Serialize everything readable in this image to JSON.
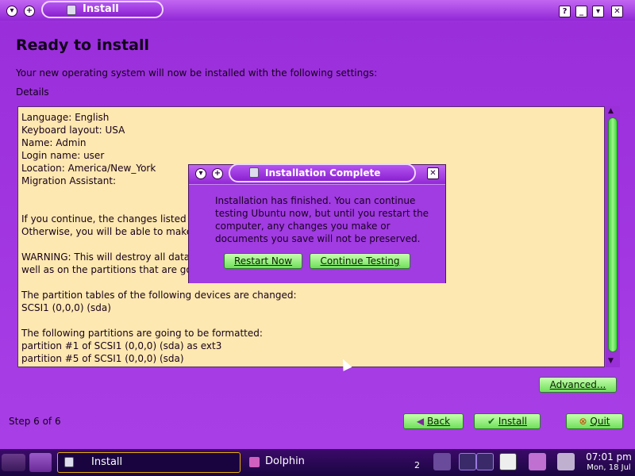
{
  "window": {
    "title": "Install",
    "heading": "Ready to install",
    "intro": "Your new operating system will now be installed with the following settings:",
    "details_label": "Details",
    "details_lines": [
      "Language: English",
      "Keyboard layout: USA",
      "Name: Admin",
      "Login name: user",
      "Location: America/New_York",
      "Migration Assistant:",
      "",
      "",
      "If you continue, the changes listed",
      "Otherwise, you will be able to make",
      "",
      "WARNING: This will destroy all data",
      "well as on the partitions that are going",
      "",
      "The partition tables of the following devices are changed:",
      "SCSI1 (0,0,0) (sda)",
      "",
      "The following partitions are going to be formatted:",
      "partition #1 of SCSI1 (0,0,0) (sda) as ext3",
      "partition #5 of SCSI1 (0,0,0) (sda)"
    ],
    "advanced_label": "Advanced...",
    "step": "Step 6 of 6",
    "back_label": "Back",
    "install_label": "Install",
    "quit_label": "Quit"
  },
  "dialog": {
    "title": "Installation Complete",
    "message": "Installation has finished. You can continue testing Ubuntu now, but until you restart the computer, any changes you make or documents you save will not be preserved.",
    "restart_label": "Restart Now",
    "continue_label": "Continue Testing"
  },
  "taskbar": {
    "task_install": "Install",
    "task_dolphin": "Dolphin",
    "desktop_number": "2",
    "time": "07:01 pm",
    "date": "Mon, 18 Jul"
  },
  "colors": {
    "window_bg": "#a23ce0",
    "details_bg": "#fce8b0",
    "button_green": "#6fe05a",
    "taskbar_bg": "#2a0850"
  }
}
